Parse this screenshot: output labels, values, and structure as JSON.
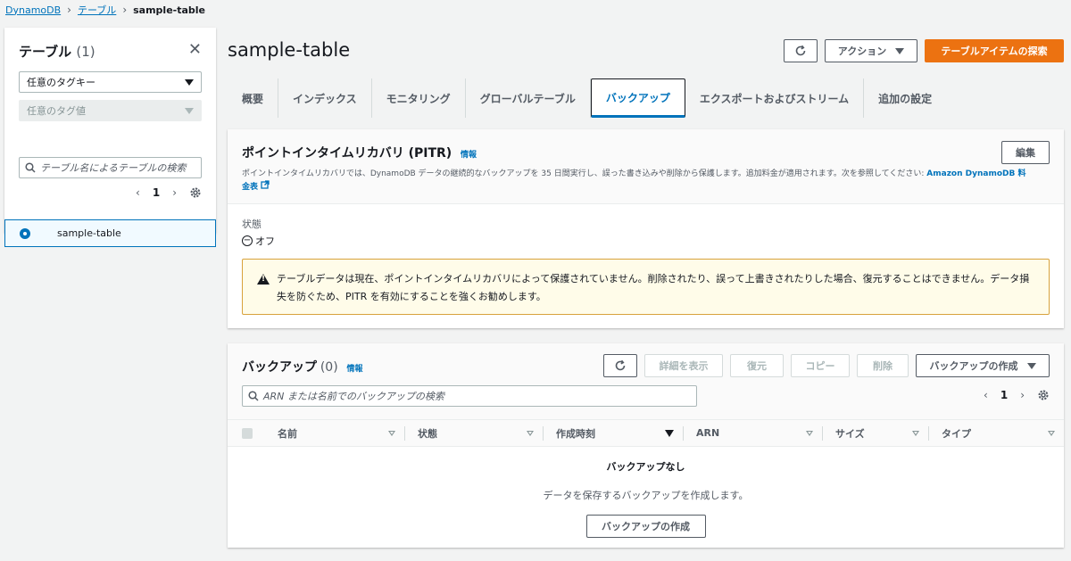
{
  "breadcrumb": {
    "root": "DynamoDB",
    "tables": "テーブル",
    "current": "sample-table"
  },
  "sidebar": {
    "title": "テーブル",
    "count": "(1)",
    "tag_key_placeholder": "任意のタグキー",
    "tag_value_placeholder": "任意のタグ値",
    "search_placeholder": "テーブル名によるテーブルの検索",
    "page": "1",
    "items": [
      {
        "label": "sample-table",
        "selected": true
      }
    ]
  },
  "header": {
    "title": "sample-table",
    "actions_label": "アクション",
    "explore_label": "テーブルアイテムの探索"
  },
  "tabs": [
    {
      "label": "概要"
    },
    {
      "label": "インデックス"
    },
    {
      "label": "モニタリング"
    },
    {
      "label": "グローバルテーブル"
    },
    {
      "label": "バックアップ",
      "active": true
    },
    {
      "label": "エクスポートおよびストリーム"
    },
    {
      "label": "追加の設定"
    }
  ],
  "pitr": {
    "title": "ポイントインタイムリカバリ (PITR)",
    "info": "情報",
    "description": "ポイントインタイムリカバリでは、DynamoDB データの継続的なバックアップを 35 日間実行し、誤った書き込みや削除から保護します。追加料金が適用されます。次を参照してください: ",
    "link_text_1": "Amazon DynamoDB 料",
    "link_text_2": "金表",
    "edit_label": "編集",
    "status_label": "状態",
    "status_value": "オフ",
    "warning_line1": "テーブルデータは現在、ポイントインタイムリカバリによって保護されていません。削除されたり、誤って上書きされたりした場合、復元することはできません。データ損",
    "warning_line2": "失を防ぐため、PITR を有効にすることを強くお勧めします。"
  },
  "backups": {
    "title": "バックアップ",
    "count": "(0)",
    "info": "情報",
    "details_label": "詳細を表示",
    "restore_label": "復元",
    "copy_label": "コピー",
    "delete_label": "削除",
    "create_label": "バックアップの作成",
    "search_placeholder": "ARN または名前でのバックアップの検索",
    "page": "1",
    "columns": [
      "名前",
      "状態",
      "作成時刻",
      "ARN",
      "サイズ",
      "タイプ"
    ],
    "empty_title": "バックアップなし",
    "empty_desc": "データを保存するバックアップを作成します。",
    "empty_button": "バックアップの作成"
  }
}
